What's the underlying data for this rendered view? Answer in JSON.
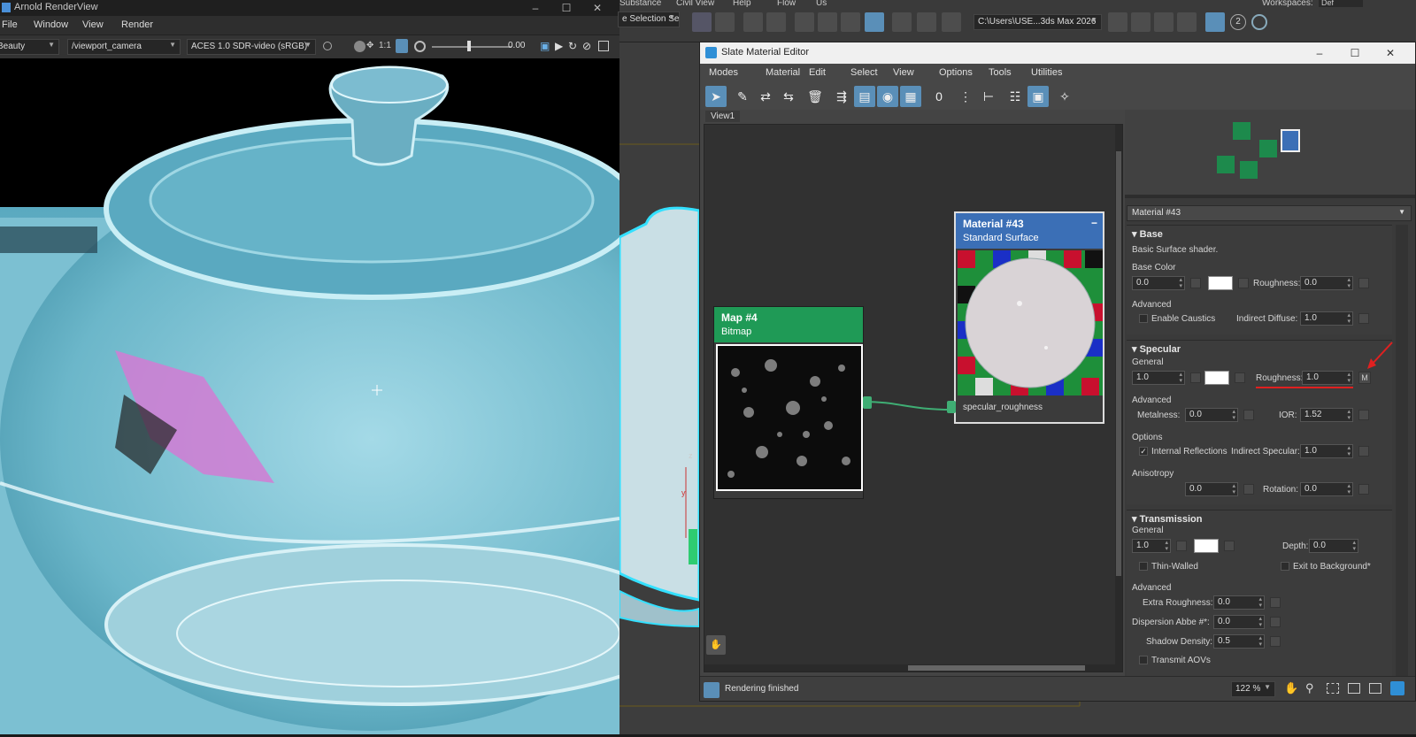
{
  "arnold": {
    "title": "Arnold RenderView",
    "menu": [
      "File",
      "Window",
      "View",
      "Render"
    ],
    "aov_combo": "Beauty",
    "camera_combo": "/viewport_camera",
    "display_combo": "ACES 1.0 SDR-video (sRGB)",
    "ratio_label": "1:1",
    "exposure_value": "0.00"
  },
  "max": {
    "menu": [
      "Substance",
      "Civil View",
      "Help",
      "Flow",
      "Us"
    ],
    "selection_set": "e Selection Se",
    "project_path": "C:\\Users\\USE...3ds Max 2026",
    "workspace_label": "Workspaces:",
    "workspace_value": "Def",
    "badge_count": "2"
  },
  "slate": {
    "title": "Slate Material Editor",
    "menu": [
      "Modes",
      "Material",
      "Edit",
      "Select",
      "View",
      "Options",
      "Tools",
      "Utilities"
    ],
    "view_tab": "View1",
    "node_bitmap": {
      "title": "Map #4",
      "subtitle": "Bitmap"
    },
    "node_material": {
      "title": "Material #43",
      "subtitle": "Standard Surface",
      "slot_label": "specular_roughness"
    },
    "material_name": "Material #43",
    "base": {
      "title": "Base",
      "desc": "Basic Surface shader.",
      "color_label": "Base Color",
      "weight": "0.0",
      "roughness_label": "Roughness:",
      "roughness": "0.0",
      "advanced_label": "Advanced",
      "caustics_label": "Enable Caustics",
      "indirect_diffuse_label": "Indirect Diffuse:",
      "indirect_diffuse": "1.0"
    },
    "specular": {
      "title": "Specular",
      "general_label": "General",
      "weight": "1.0",
      "roughness_label": "Roughness:",
      "roughness": "1.0",
      "map_button": "M",
      "advanced_label": "Advanced",
      "metalness_label": "Metalness:",
      "metalness": "0.0",
      "ior_label": "IOR:",
      "ior": "1.52",
      "options_label": "Options",
      "internal_reflections_label": "Internal Reflections",
      "internal_reflections_check": "✓",
      "indirect_specular_label": "Indirect Specular:",
      "indirect_specular": "1.0",
      "anisotropy_label": "Anisotropy",
      "anisotropy": "0.0",
      "rotation_label": "Rotation:",
      "rotation": "0.0"
    },
    "transmission": {
      "title": "Transmission",
      "general_label": "General",
      "weight": "1.0",
      "depth_label": "Depth:",
      "depth": "0.0",
      "thin_walled_label": "Thin-Walled",
      "exit_bg_label": "Exit to Background*",
      "advanced_label": "Advanced",
      "extra_roughness_label": "Extra Roughness:",
      "extra_roughness": "0.0",
      "dispersion_label": "Dispersion Abbe #*:",
      "dispersion": "0.0",
      "shadow_density_label": "Shadow Density:",
      "shadow_density": "0.5",
      "transmit_aovs_label": "Transmit AOVs"
    },
    "status_text": "Rendering finished",
    "zoom": "122 %"
  },
  "colors": {
    "material_header": "#3b6fb6",
    "bitmap_header": "#1f9a56",
    "wire": "#3fae74",
    "annotation_red": "#e02020"
  }
}
